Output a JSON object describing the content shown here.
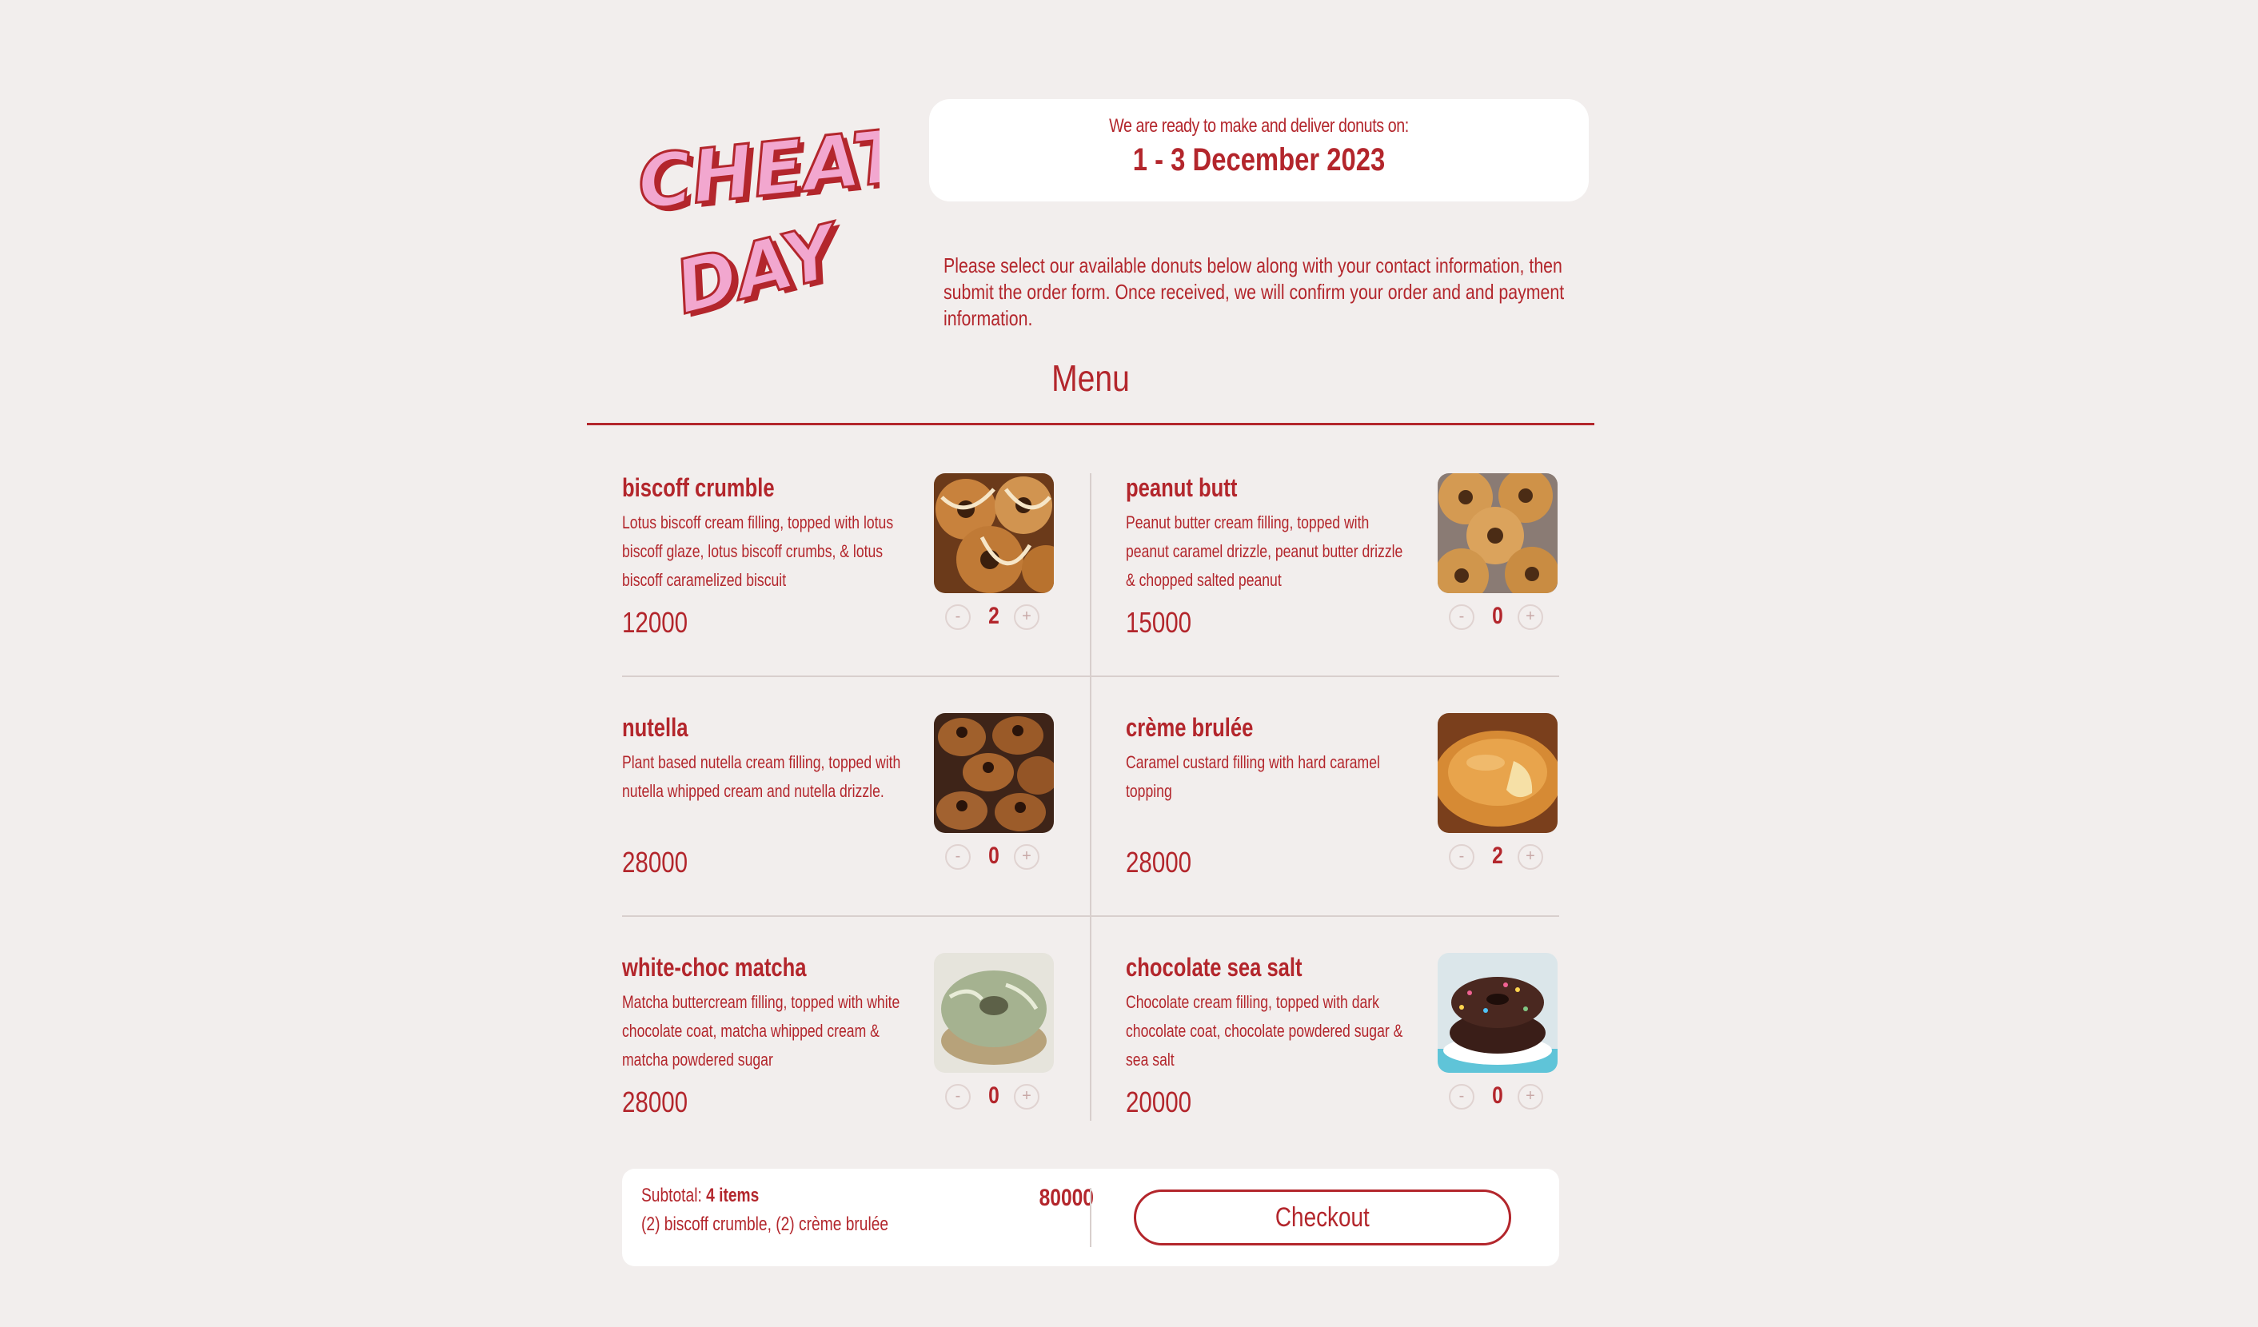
{
  "header": {
    "logo_text": "CHEAT DAY",
    "delivery_lead": "We are ready to make and deliver donuts on:",
    "delivery_dates": "1 - 3 December 2023",
    "intro": "Please select our available donuts below along with your contact information, then submit the order form. Once received, we will confirm your order and and payment information."
  },
  "menu": {
    "title": "Menu",
    "items": [
      {
        "name": "biscoff crumble",
        "desc": "Lotus biscoff cream filling, topped with lotus biscoff glaze, lotus biscoff crumbs, & lotus biscoff caramelized biscuit",
        "price": "12000",
        "qty": "2",
        "minus": "-",
        "plus": "+"
      },
      {
        "name": "peanut butt",
        "desc": "Peanut butter cream filling, topped with peanut caramel drizzle, peanut butter drizzle & chopped salted peanut",
        "price": "15000",
        "qty": "0",
        "minus": "-",
        "plus": "+"
      },
      {
        "name": "nutella",
        "desc": "Plant based nutella cream filling, topped with nutella whipped cream and nutella drizzle.",
        "price": "28000",
        "qty": "0",
        "minus": "-",
        "plus": "+"
      },
      {
        "name": "crème brulée",
        "desc": "Caramel custard filling with hard caramel topping",
        "price": "28000",
        "qty": "2",
        "minus": "-",
        "plus": "+"
      },
      {
        "name": "white-choc matcha",
        "desc": "Matcha buttercream filling, topped with white chocolate coat, matcha whipped cream & matcha powdered sugar",
        "price": "28000",
        "qty": "0",
        "minus": "-",
        "plus": "+"
      },
      {
        "name": "chocolate sea salt",
        "desc": "Chocolate cream filling, topped with dark chocolate coat, chocolate powdered sugar & sea salt",
        "price": "20000",
        "qty": "0",
        "minus": "-",
        "plus": "+"
      }
    ]
  },
  "cart": {
    "subtotal_label": "Subtotal:",
    "items_count": "4 items",
    "items_list": "(2) biscoff crumble, (2) crème brulée",
    "total": "80000",
    "checkout_label": "Checkout"
  },
  "colors": {
    "accent": "#b3262c",
    "background": "#f2eeed",
    "logo_pink": "#f2a7cf"
  }
}
